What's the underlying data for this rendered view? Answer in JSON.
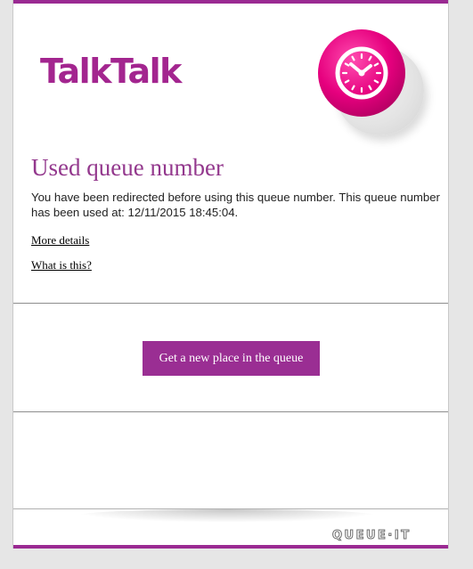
{
  "brand": {
    "name": "TalkTalk",
    "accent_color": "#9a2e93",
    "logo_color": "#a3258f",
    "badge_color": "#e6007e"
  },
  "header": {
    "badge_icon": "clock-icon"
  },
  "content": {
    "title": "Used queue number",
    "message": "You have been redirected before using this queue number. This queue number has been used at: 12/11/2015 18:45:04.",
    "link_more_details": "More details",
    "link_what_is_this": "What is this?"
  },
  "action": {
    "new_place_button": "Get a new place in the queue"
  },
  "footer": {
    "provider_logo": "QUEUE·IT"
  }
}
